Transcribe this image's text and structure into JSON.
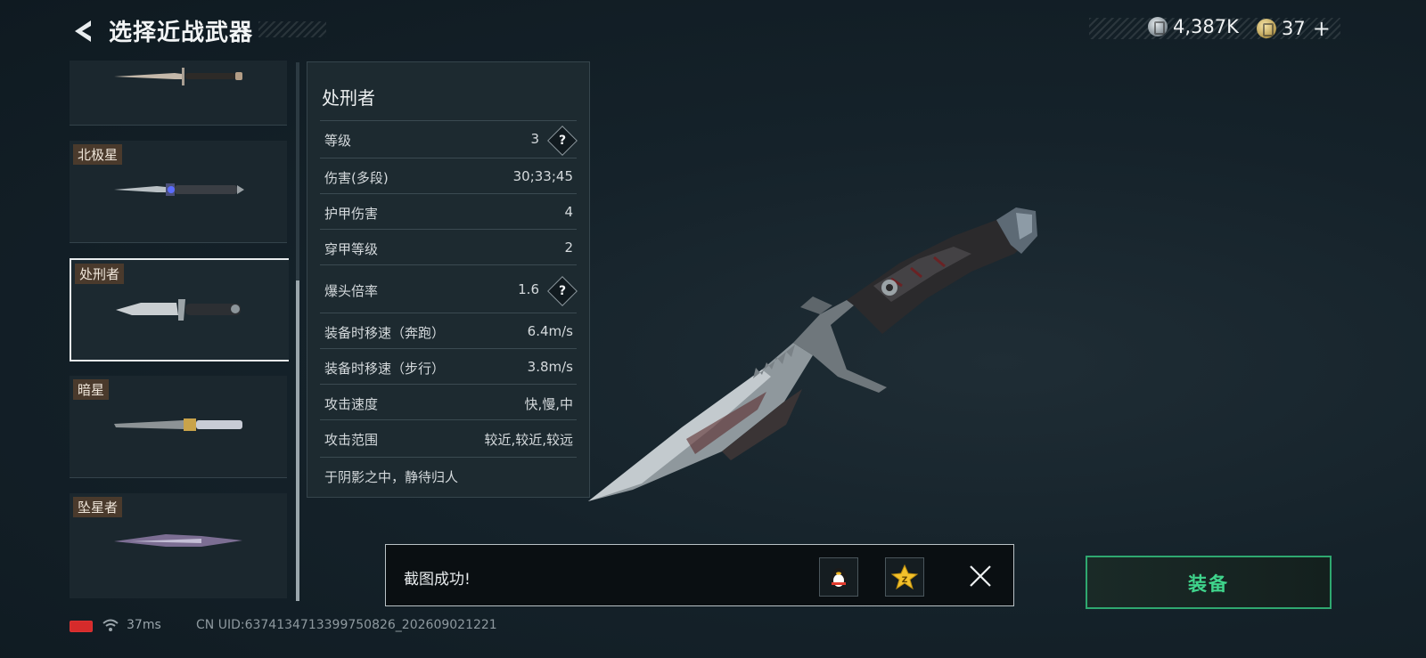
{
  "header": {
    "title": "选择近战武器"
  },
  "currency": {
    "silver": "4,387K",
    "gold": "37",
    "add": "+"
  },
  "weapons": [
    {
      "name": ""
    },
    {
      "name": "北极星"
    },
    {
      "name": "处刑者",
      "selected": true
    },
    {
      "name": "暗星"
    },
    {
      "name": "坠星者"
    }
  ],
  "detail": {
    "title": "处刑者",
    "stats": [
      {
        "label": "等级",
        "value": "3",
        "help": "?"
      },
      {
        "label": "伤害(多段)",
        "value": "30;33;45"
      },
      {
        "label": "护甲伤害",
        "value": "4"
      },
      {
        "label": "穿甲等级",
        "value": "2"
      },
      {
        "label": "爆头倍率",
        "value": "1.6",
        "help": "?"
      },
      {
        "label": "装备时移速（奔跑）",
        "value": "6.4m/s"
      },
      {
        "label": "装备时移速（步行）",
        "value": "3.8m/s"
      },
      {
        "label": "攻击速度",
        "value": "快,慢,中"
      },
      {
        "label": "攻击范围",
        "value": "较近,较近,较远"
      }
    ],
    "description": "于阴影之中，静待归人"
  },
  "toast": {
    "message": "截图成功!",
    "share1_icon": "penguin-icon",
    "share2_icon": "star-icon",
    "close_icon": "close-icon"
  },
  "equip": {
    "label": "装备"
  },
  "footer": {
    "ping": "37ms",
    "uid": "CN UID:6374134713399750826_202609021221"
  },
  "colors": {
    "equip_green": "#3fd48c",
    "battery_red": "#d62b2b",
    "label_bg": "#4a3a2c"
  }
}
